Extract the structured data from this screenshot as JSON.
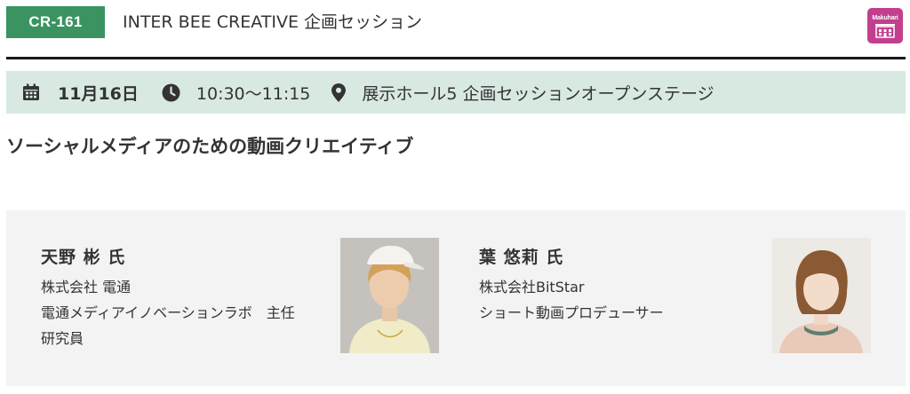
{
  "header": {
    "session_code": "CR-161",
    "category": "INTER BEE CREATIVE 企画セッション",
    "venue_logo_text": "Makuhari",
    "venue_logo_icon": "building-icon"
  },
  "info_bar": {
    "date": "11月16日",
    "time": "10:30〜11:15",
    "place": "展示ホール5 企画セッションオープンステージ",
    "icons": [
      "calendar-icon",
      "clock-icon",
      "map-pin-icon"
    ]
  },
  "session": {
    "title": "ソーシャルメディアのための動画クリエイティブ"
  },
  "speakers": [
    {
      "name": "天野 彬 氏",
      "org_lines": [
        "株式会社 電通",
        "電通メディアイノベーションラボ　主任",
        "研究員"
      ]
    },
    {
      "name": "葉 悠莉 氏",
      "org_lines": [
        "株式会社BitStar",
        "ショート動画プロデューサー"
      ]
    }
  ],
  "colors": {
    "code_badge": "#3a9360",
    "info_bar_bg": "#d8e9e2",
    "venue_logo": "#c23f8e",
    "speakers_bg": "#f3f3f3"
  }
}
